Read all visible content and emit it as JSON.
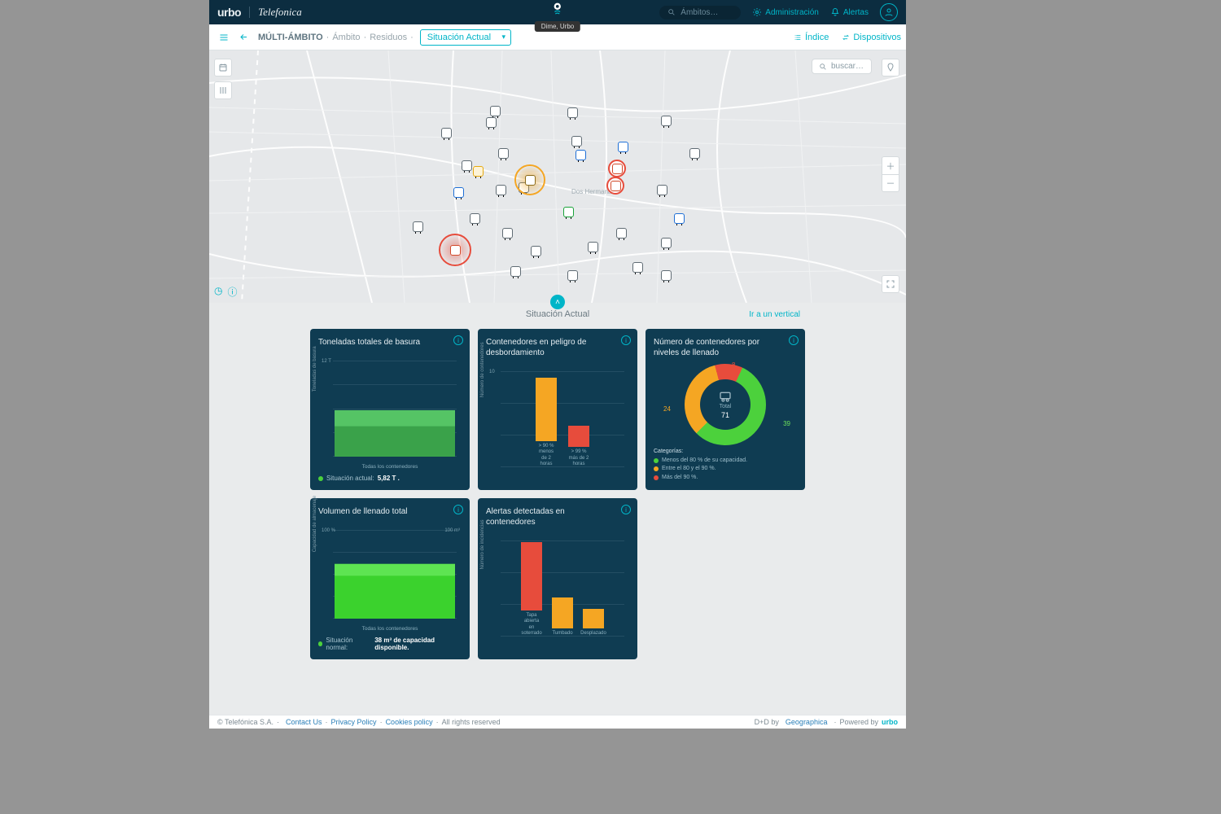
{
  "header": {
    "logo": "urbo",
    "partner": "Telefonica",
    "badge": "Dime, Urbo",
    "search_placeholder": "Ámbitos…",
    "admin": "Administración",
    "alerts": "Alertas"
  },
  "breadcrumb": {
    "root": "MÚLTI-ÁMBITO",
    "ambito": "Ámbito",
    "residuo": "Residuos",
    "current": "Situación Actual",
    "indice": "Índice",
    "dispositivos": "Dispositivos"
  },
  "map": {
    "search_placeholder": "buscar…",
    "city_label": "Dos Hermanas"
  },
  "section": {
    "title": "Situación Actual",
    "link": "Ir a un vertical"
  },
  "cards": {
    "tons": {
      "title": "Toneladas totales de basura",
      "xcat": "Todas los contenedores",
      "ylabel": "Toneladas de basura",
      "ymax": "12 T",
      "note_label": "Situación actual:",
      "note_value": "5,82 T ."
    },
    "overflow": {
      "title": "Contenedores en peligro de desbordamiento",
      "ylabel": "Número de contenedores",
      "ymax": "10",
      "cat1a": "> 90 %",
      "cat1b": "menos de 2 horas",
      "cat2a": "> 99 %",
      "cat2b": "más de 2 horas"
    },
    "donut": {
      "title": "Número de contenedores por niveles de llenado",
      "center_label": "Total",
      "center_value": "71",
      "v_green": "39",
      "v_orange": "24",
      "v_red": "8",
      "legend_title": "Categorías:",
      "leg1": "Menos del 80 % de su capacidad.",
      "leg2": "Entre el 80 y el 90 %.",
      "leg3": "Más del 90 %."
    },
    "volume": {
      "title": "Volumen de llenado total",
      "ylabel": "Capacidad de almacenaje",
      "yl": "100 %",
      "yr": "100 m³",
      "xcat": "Todas los contenedores",
      "note_label": "Situación normal:",
      "note_value": "38 m³ de capacidad disponible."
    },
    "alerts": {
      "title": "Alertas detectadas en contenedores",
      "ylabel": "Número de incidencias",
      "cat1": "Tapa abierta en soterrado",
      "cat2": "Tumbado",
      "cat3": "Desplazado"
    }
  },
  "chart_data": [
    {
      "type": "bar",
      "title": "Toneladas totales de basura",
      "categories": [
        "Todas los contenedores"
      ],
      "values": [
        5.82
      ],
      "ylim": [
        0,
        12
      ],
      "ylabel": "Toneladas de basura"
    },
    {
      "type": "bar",
      "title": "Contenedores en peligro de desbordamiento",
      "categories": [
        "> 90 % menos de 2 horas",
        "> 99 % más de 2 horas"
      ],
      "values": [
        6,
        2
      ],
      "ylim": [
        0,
        10
      ],
      "ylabel": "Número de contenedores",
      "colors": [
        "#f5a623",
        "#e74c3c"
      ]
    },
    {
      "type": "pie",
      "title": "Número de contenedores por niveles de llenado",
      "series": [
        {
          "name": "Menos del 80 % de su capacidad.",
          "value": 39,
          "color": "#4cd13c"
        },
        {
          "name": "Entre el 80 y el 90 %.",
          "value": 24,
          "color": "#f5a623"
        },
        {
          "name": "Más del 90 %.",
          "value": 8,
          "color": "#e74c3c"
        }
      ],
      "total": 71
    },
    {
      "type": "area",
      "title": "Volumen de llenado total",
      "categories": [
        "Todas los contenedores"
      ],
      "values": [
        62
      ],
      "ylim": [
        0,
        100
      ],
      "ylabel": "Capacidad de almacenaje (%)",
      "y2label": "m³",
      "y2lim": [
        0,
        100
      ]
    },
    {
      "type": "bar",
      "title": "Alertas detectadas en contenedores",
      "categories": [
        "Tapa abierta en soterrado",
        "Tumbado",
        "Desplazado"
      ],
      "values": [
        11,
        5,
        3
      ],
      "ylim": [
        0,
        12
      ],
      "ylabel": "Número de incidencias",
      "colors": [
        "#e74c3c",
        "#f5a623",
        "#f5a623"
      ]
    }
  ],
  "footer": {
    "copyright": "© Telefónica S.A.",
    "contact": "Contact Us",
    "privacy": "Privacy Policy",
    "cookies": "Cookies policy",
    "rights": "All rights reserved",
    "dby": "D+D by",
    "geo": "Geographica",
    "powered": "Powered by",
    "plogo": "urbo"
  }
}
